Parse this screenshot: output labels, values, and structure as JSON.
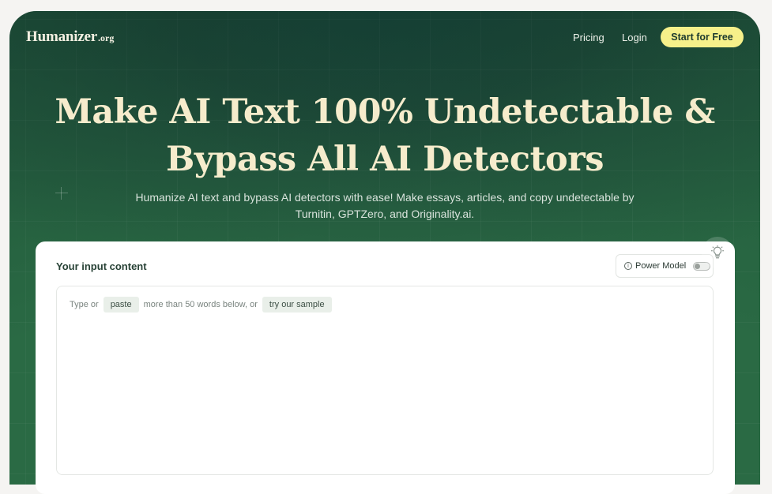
{
  "nav": {
    "logo_main": "Humanizer",
    "logo_sub": ".org",
    "pricing": "Pricing",
    "login": "Login",
    "cta": "Start for Free"
  },
  "hero": {
    "headline_line1": "Make AI Text 100% Undetectable &",
    "headline_line2": "Bypass All AI Detectors",
    "subline_line1": "Humanize AI text and bypass AI detectors with ease! Make essays, articles, and copy undetectable by",
    "subline_line2": "Turnitin, GPTZero, and Originality.ai."
  },
  "card": {
    "title": "Your input content",
    "power_model_label": "Power Model",
    "power_model_enabled": false,
    "hint_prefix": "Type or",
    "paste_label": "paste",
    "hint_middle": "more than 50 words below, or",
    "sample_label": "try our sample"
  },
  "colors": {
    "hero_green": "#1f4d3a",
    "headline_cream": "#f6eccc",
    "cta_yellow": "#f6f08a"
  },
  "icons": [
    "info-icon",
    "toggle-switch",
    "lightbulb-icon",
    "plus-decoration"
  ]
}
